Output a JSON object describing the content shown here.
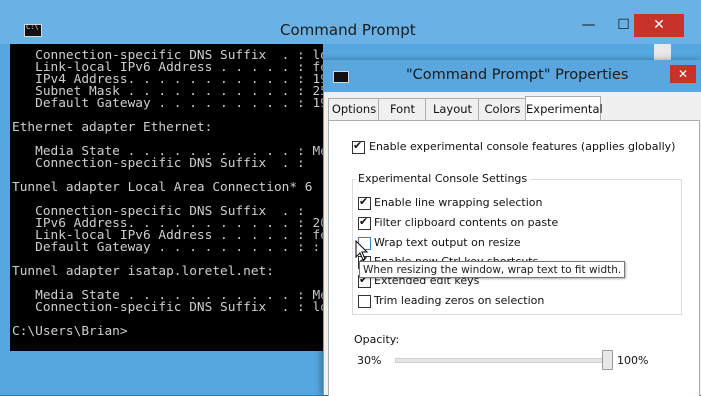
{
  "cmd": {
    "title": "Command Prompt",
    "min_glyph": "—",
    "max_glyph": "☐",
    "close_glyph": "✕",
    "lines": [
      "   Connection-specific DNS Suffix  . : lor",
      "   Link-local IPv6 Address . . . . . : fe",
      "   IPv4 Address. . . . . . . . . . . : 19",
      "   Subnet Mask . . . . . . . . . . . : 25",
      "   Default Gateway . . . . . . . . . : 19",
      "",
      "Ethernet adapter Ethernet:",
      "",
      "   Media State . . . . . . . . . . . : Me",
      "   Connection-specific DNS Suffix  . :",
      "",
      "Tunnel adapter Local Area Connection* 6",
      "",
      "   Connection-specific DNS Suffix  . :",
      "   IPv6 Address. . . . . . . . . . . : 20",
      "   Link-local IPv6 Address . . . . . : fe",
      "   Default Gateway . . . . . . . . . : ::",
      "",
      "Tunnel adapter isatap.loretel.net:",
      "",
      "   Media State . . . . . . . . . . . : Me",
      "   Connection-specific DNS Suffix  . : lo",
      "",
      "C:\\Users\\Brian>"
    ]
  },
  "dialog": {
    "title": "\"Command Prompt\" Properties",
    "close_glyph": "✕",
    "tabs": [
      "Options",
      "Font",
      "Layout",
      "Colors",
      "Experimental"
    ],
    "selected_tab": "Experimental",
    "enable_experimental": {
      "label": "Enable experimental console features (applies globally)",
      "checked": true
    },
    "group_title": "Experimental Console Settings",
    "settings": [
      {
        "label": "Enable line wrapping selection",
        "checked": true
      },
      {
        "label": "Filter clipboard contents on paste",
        "checked": true
      },
      {
        "label": "Wrap text output on resize",
        "checked": false
      },
      {
        "label": "Enable new Ctrl key shortcuts",
        "checked": true
      },
      {
        "label": "Extended edit keys",
        "checked": true
      },
      {
        "label": "Trim leading zeros on selection",
        "checked": false
      }
    ],
    "opacity": {
      "label": "Opacity:",
      "min_label": "30%",
      "max_label": "100%",
      "value_percent": 100
    },
    "tooltip": "When resizing the window, wrap text to fit width."
  }
}
